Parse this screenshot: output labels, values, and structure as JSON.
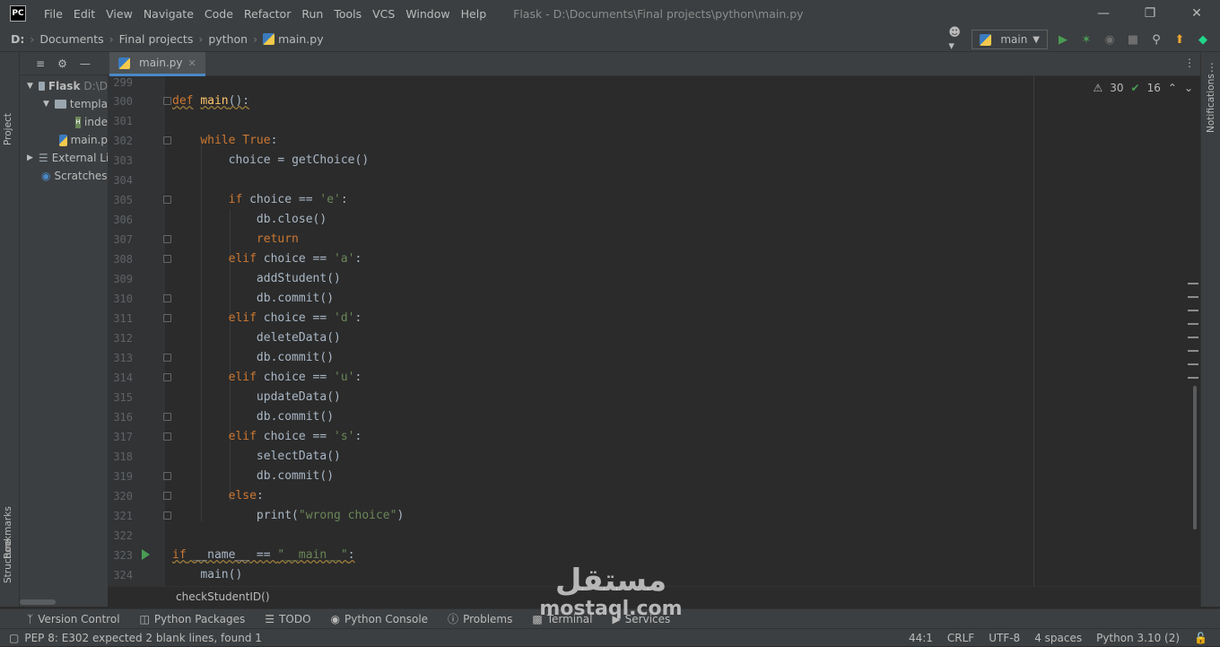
{
  "titlebar": {
    "app_logo": "PC",
    "menu": [
      "File",
      "Edit",
      "View",
      "Navigate",
      "Code",
      "Refactor",
      "Run",
      "Tools",
      "VCS",
      "Window",
      "Help"
    ],
    "window_title": "Flask - D:\\Documents\\Final projects\\python\\main.py"
  },
  "navbar": {
    "crumbs": [
      "D:",
      "Documents",
      "Final projects",
      "python",
      "main.py"
    ],
    "run_config": "main"
  },
  "left_strip": {
    "project": "Project",
    "bookmarks": "Bookmarks",
    "structure": "Structure"
  },
  "project_tree": [
    {
      "label": "Flask",
      "extra": "D:\\D"
    },
    {
      "label": "templa"
    },
    {
      "label": "inde"
    },
    {
      "label": "main.p"
    },
    {
      "label": "External Li"
    },
    {
      "label": "Scratches a"
    }
  ],
  "tab": {
    "label": "main.py",
    "close": "✕"
  },
  "inspections": {
    "warnings": "30",
    "weak": "16"
  },
  "right_strip": {
    "notifications": "Notifications"
  },
  "code_lines": [
    {
      "n": "299"
    },
    {
      "n": "300"
    },
    {
      "n": "301"
    },
    {
      "n": "302"
    },
    {
      "n": "303"
    },
    {
      "n": "304"
    },
    {
      "n": "305"
    },
    {
      "n": "306"
    },
    {
      "n": "307"
    },
    {
      "n": "308"
    },
    {
      "n": "309"
    },
    {
      "n": "310"
    },
    {
      "n": "311"
    },
    {
      "n": "312"
    },
    {
      "n": "313"
    },
    {
      "n": "314"
    },
    {
      "n": "315"
    },
    {
      "n": "316"
    },
    {
      "n": "317"
    },
    {
      "n": "318"
    },
    {
      "n": "319"
    },
    {
      "n": "320"
    },
    {
      "n": "321"
    },
    {
      "n": "322"
    },
    {
      "n": "323"
    },
    {
      "n": "324"
    }
  ],
  "code": {
    "def": "def",
    "main": "main",
    "main_rest": "():",
    "while": "while",
    "true": "True",
    "colon": ":",
    "choice_assign": "choice = getChoice()",
    "if": "if",
    "elif": "elif",
    "cmp": " choice == ",
    "e": "'e'",
    "a": "'a'",
    "d": "'d'",
    "u": "'u'",
    "s": "'s'",
    "db_close": "db.close()",
    "return": "return",
    "add_student": "addStudent()",
    "db_commit": "db.commit()",
    "delete_data": "deleteData()",
    "update_data": "updateData()",
    "select_data": "selectData()",
    "else": "else",
    "print": "print(",
    "wrong_choice": "\"wrong choice\"",
    "close_paren": ")",
    "dunder_name": "__name__",
    "eqeq": " == ",
    "dunder_main": "\"__main__\"",
    "main_call": "main()"
  },
  "breadcrumb_bar": "checkStudentID()",
  "tool_windows": [
    "Version Control",
    "Python Packages",
    "TODO",
    "Python Console",
    "Problems",
    "Terminal",
    "Services"
  ],
  "status": {
    "message": "PEP 8: E302 expected 2 blank lines, found 1",
    "position": "44:1",
    "line_sep": "CRLF",
    "encoding": "UTF-8",
    "indent": "4 spaces",
    "interpreter": "Python 3.10 (2)"
  },
  "watermark": {
    "arabic": "مستقل",
    "latin": "mostaql.com"
  },
  "colors": {
    "keyword": "#cc7832",
    "function": "#ffc66d",
    "string": "#6a8759",
    "text": "#a9b7c6",
    "accent": "#4a88c7"
  }
}
